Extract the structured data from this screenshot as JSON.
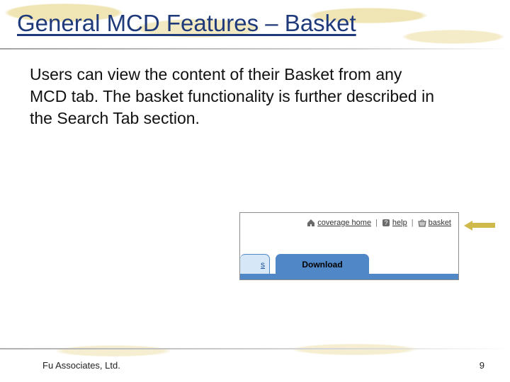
{
  "title": "General MCD Features – Basket",
  "body": "Users can view the content of their Basket from any MCD tab.  The basket functionality is further described in the Search Tab section.",
  "screenshot": {
    "utility_links": {
      "coverage_home": "coverage home",
      "help": "help",
      "basket": "basket",
      "separator": "|"
    },
    "tabs": {
      "partial_prev": "s",
      "active": "Download"
    }
  },
  "footer": {
    "company": "Fu Associates, Ltd.",
    "page_number": "9"
  },
  "icons": {
    "home": "home-icon",
    "help": "help-icon",
    "basket": "basket-icon"
  }
}
